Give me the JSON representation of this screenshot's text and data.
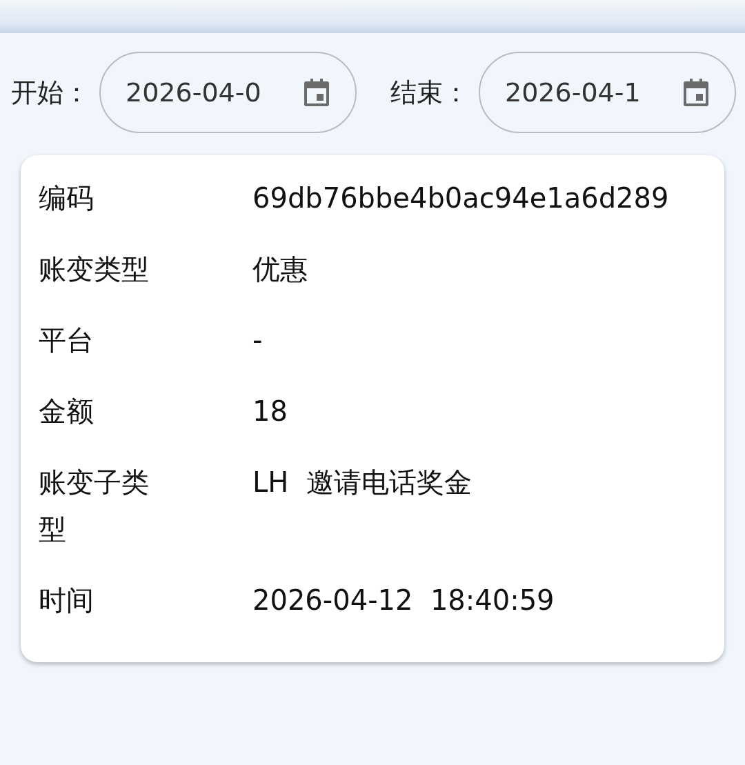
{
  "date_range": [
    {
      "label": "开始：",
      "value": "2026-04-0"
    },
    {
      "label": "结束：",
      "value": "2026-04-1"
    }
  ],
  "record": {
    "fields": [
      {
        "label": "编码",
        "value": "69db76bbe4b0ac94e1a6d289"
      },
      {
        "label": "账变类型",
        "value": "优惠"
      },
      {
        "label": "平台",
        "value": "-"
      },
      {
        "label": "金额",
        "value": "18"
      },
      {
        "label": "账变子类型",
        "value": "LH  邀请电话奖金"
      },
      {
        "label": "时间",
        "value": "2026-04-12  18:40:59"
      }
    ]
  }
}
